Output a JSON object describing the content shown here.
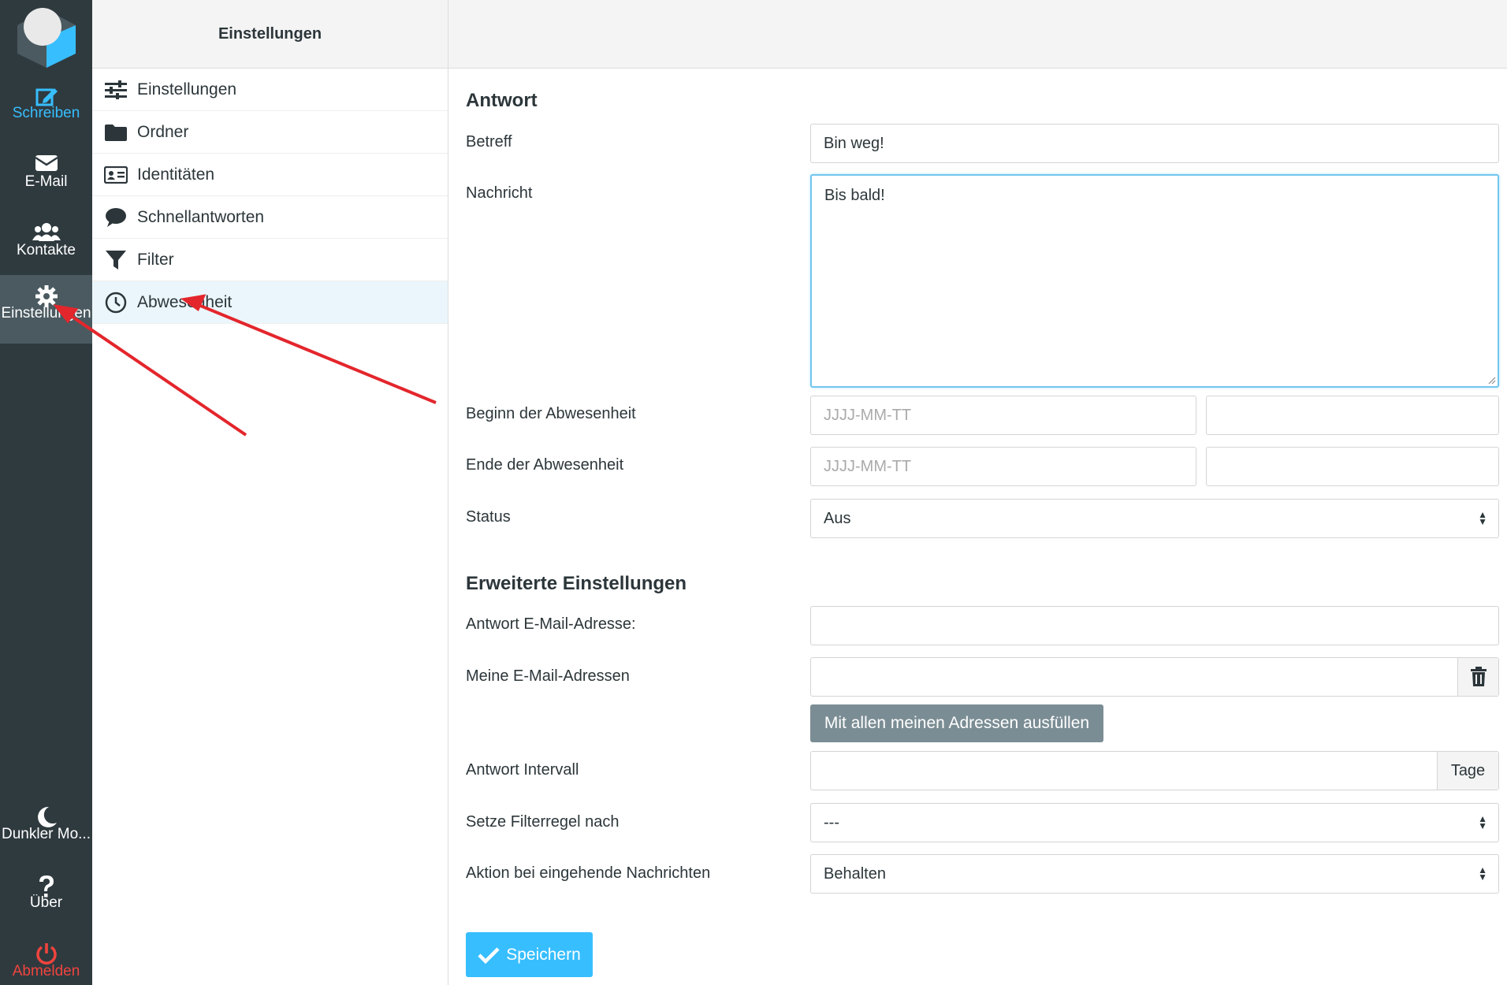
{
  "nav": {
    "compose": "Schreiben",
    "mail": "E-Mail",
    "contacts": "Kontakte",
    "settings": "Einstellungen",
    "dark_mode": "Dunkler Mo...",
    "about": "Über",
    "logout": "Abmelden"
  },
  "sidebar": {
    "title": "Einstellungen",
    "items": [
      {
        "label": "Einstellungen",
        "icon": "sliders-icon"
      },
      {
        "label": "Ordner",
        "icon": "folder-icon"
      },
      {
        "label": "Identitäten",
        "icon": "id-card-icon"
      },
      {
        "label": "Schnellantworten",
        "icon": "comment-icon"
      },
      {
        "label": "Filter",
        "icon": "filter-icon"
      },
      {
        "label": "Abwesenheit",
        "icon": "clock-icon",
        "active": true
      }
    ]
  },
  "form": {
    "reply_title": "Antwort",
    "subject_label": "Betreff",
    "subject_value": "Bin weg!",
    "message_label": "Nachricht",
    "message_value": "Bis bald!",
    "start_label": "Beginn der Abwesenheit",
    "start_placeholder": "JJJJ-MM-TT",
    "end_label": "Ende der Abwesenheit",
    "end_placeholder": "JJJJ-MM-TT",
    "status_label": "Status",
    "status_value": "Aus",
    "advanced_title": "Erweiterte Einstellungen",
    "reply_address_label": "Antwort E-Mail-Adresse:",
    "my_addresses_label": "Meine E-Mail-Adressen",
    "fill_button": "Mit allen meinen Adressen ausfüllen",
    "interval_label": "Antwort Intervall",
    "interval_unit": "Tage",
    "filter_rule_label": "Setze Filterregel nach",
    "filter_rule_value": "---",
    "action_label": "Aktion bei eingehende Nachrichten",
    "action_value": "Behalten",
    "save_button": "Speichern"
  },
  "colors": {
    "nav_bg": "#2f3a3f",
    "accent": "#37beff",
    "logout": "#f0443d",
    "annotation_arrow": "#e3262c"
  }
}
